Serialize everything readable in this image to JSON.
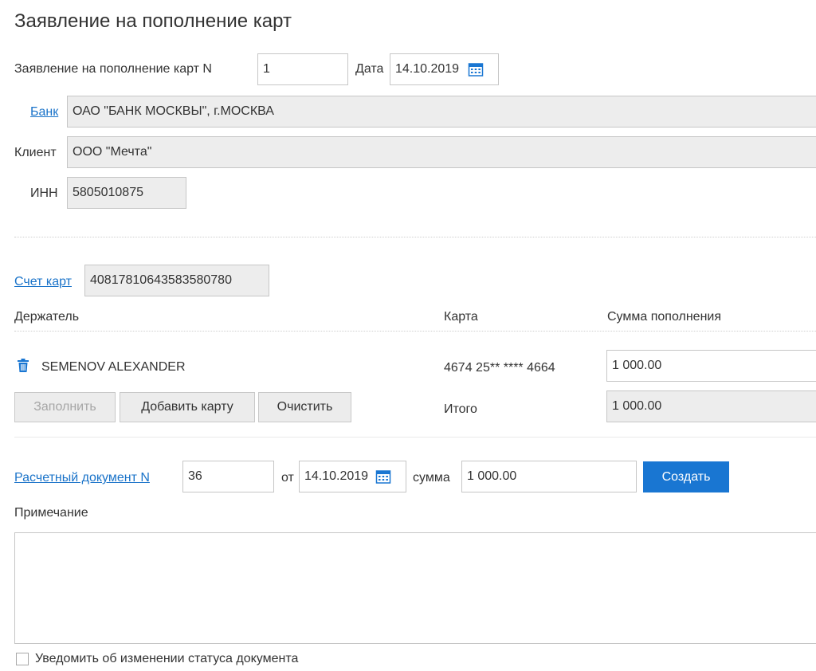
{
  "page": {
    "title": "Заявление на пополнение карт"
  },
  "header": {
    "number_label": "Заявление на пополнение карт  N",
    "number_value": "1",
    "date_label": "Дата",
    "date_value": "14.10.2019"
  },
  "bank": {
    "label": "Банк",
    "value": "ОАО \"БАНК МОСКВЫ\", г.МОСКВА"
  },
  "client": {
    "label": "Клиент",
    "value": "ООО \"Мечта\""
  },
  "inn": {
    "label": "ИНН",
    "value": "5805010875"
  },
  "account": {
    "label": "Счет карт",
    "value": "40817810643583580780"
  },
  "table": {
    "col_holder": "Держатель",
    "col_card": "Карта",
    "col_amount": "Сумма пополнения",
    "rows": [
      {
        "holder": "SEMENOV ALEXANDER",
        "card": "4674 25** **** 4664",
        "amount": "1 000.00"
      }
    ],
    "total_label": "Итого",
    "total_value": "1 000.00"
  },
  "buttons": {
    "fill": "Заполнить",
    "add_card": "Добавить карту",
    "clear": "Очистить",
    "create": "Создать"
  },
  "payment": {
    "label": "Расчетный документ N",
    "number": "36",
    "from_label": "от",
    "date": "14.10.2019",
    "sum_label": "сумма",
    "sum": "1 000.00"
  },
  "note": {
    "label": "Примечание",
    "value": ""
  },
  "notify": {
    "label": "Уведомить об изменении статуса документа",
    "checked": false
  },
  "icons": {
    "calendar": "calendar-icon",
    "trash": "trash-icon"
  },
  "colors": {
    "accent": "#1976d2",
    "link": "#1a73c9"
  }
}
